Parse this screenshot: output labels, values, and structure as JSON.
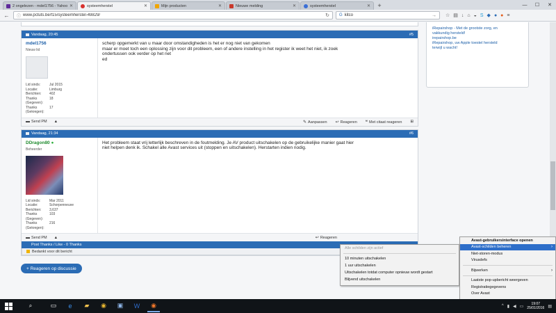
{
  "browser": {
    "tabs": [
      {
        "label": "2 ongelezen - mdel1756 - Yahoo",
        "favicon_color": "#5f2b9b",
        "active": false
      },
      {
        "label": "systeemherstel",
        "favicon_color": "#d8322f",
        "active": true
      },
      {
        "label": "Mijn producten",
        "favicon_color": "#f0a500",
        "active": false
      },
      {
        "label": "Nieuwe melding",
        "favicon_color": "#c9392b",
        "active": false
      },
      {
        "label": "systeemherstel",
        "favicon_color": "#3b6fd6",
        "active": false
      }
    ],
    "new_tab": "+",
    "url": "www.pctuts.be/f15/systeemherstel-49829/",
    "search_value": "kitco"
  },
  "sidebar": {
    "lines": [
      "iRepairshop - Met de grootste zorg, en",
      "vakkundig hersteld!",
      "irepairshop.be",
      "iRepairshop, uw Apple toestel hersteld",
      "terwijl u wacht!"
    ]
  },
  "posts": [
    {
      "date": "Vandaag, 20:45",
      "post_number": "#5",
      "username": "mdel1756",
      "role": "Nieuw lid",
      "stats": [
        {
          "k": "Lid sinds:",
          "v": "Jul 2015"
        },
        {
          "k": "Locatie:",
          "v": "Limburg"
        },
        {
          "k": "Berichten:",
          "v": "402"
        },
        {
          "k": "Thanks (Gegeven):",
          "v": "18"
        },
        {
          "k": "Thanks (Gekregen):",
          "v": "17"
        }
      ],
      "message_lines": [
        "scherp opgemerkt van u maar door omstandigheden is het er nog niet van gekomen",
        "maar er moet toch een oplossing zijn voor dit probleem, een of andere instelling in het register ik weet het niet, ik zoek",
        "ondertussen ook verder op het net",
        "ed"
      ],
      "footer": {
        "send_pm": "Send PM",
        "report": "Rapporteer",
        "quote": "Aanpassen",
        "reply": "Reageren",
        "reply_quote": "Met citaat reageren"
      }
    },
    {
      "date": "Vandaag, 21:34",
      "post_number": "#6",
      "username": "DDragon80",
      "role": "Beheerder",
      "stats": [
        {
          "k": "Lid sinds:",
          "v": "Mar 2011"
        },
        {
          "k": "Locatie:",
          "v": "Schorpenneuve"
        },
        {
          "k": "Berichten:",
          "v": "3,637"
        },
        {
          "k": "Thanks (Gegeven):",
          "v": "103"
        },
        {
          "k": "Thanks (Gekregen):",
          "v": "216"
        }
      ],
      "message_lines": [
        "Het probleem staat vrij letterlijk beschreven in de foutmelding. Je AV product uitschakelen op de gebruikelijke manier gaat hier",
        "niet helpen denk ik. Schakel alle Avast services uit (stoppen en uitschakelen). Herstarten indien nodig."
      ],
      "footer": {
        "send_pm": "Send PM",
        "reply": "Reageren"
      }
    }
  ],
  "thanks_bar": "Post Thanks / Like - 0 Thanks",
  "thanks_user": "Bedankt voor dit bericht",
  "reply_button": "+ Reageren op discussie",
  "avast_menu": {
    "items": [
      {
        "label": "Avast-gebruikersinterface openen",
        "type": "header"
      },
      {
        "label": "Avast-schilden beheren",
        "type": "highlight",
        "submenu": true
      },
      {
        "label": "Niet-storen-modus",
        "type": "normal"
      },
      {
        "label": "Virusdefs",
        "type": "normal"
      },
      {
        "label": "Bijwerken",
        "type": "normal",
        "submenu": true
      },
      {
        "label": "Laatste pop-upbericht weergeven",
        "type": "normal"
      },
      {
        "label": "Registratiegegevens",
        "type": "normal"
      },
      {
        "label": "Over Avast",
        "type": "normal"
      }
    ]
  },
  "shields_submenu": {
    "items": [
      {
        "label": "Alle schilden zijn actief",
        "type": "disabled"
      },
      {
        "label": "10 minuten uitschakelen",
        "type": "normal"
      },
      {
        "label": "1 uur uitschakelen",
        "type": "normal"
      },
      {
        "label": "Uitschakelen totdat computer opnieuw wordt gestart",
        "type": "normal"
      },
      {
        "label": "Blijvend uitschakelen",
        "type": "normal"
      }
    ]
  },
  "taskbar": {
    "clock_time": "19:07",
    "clock_date": "25/01/2016"
  }
}
